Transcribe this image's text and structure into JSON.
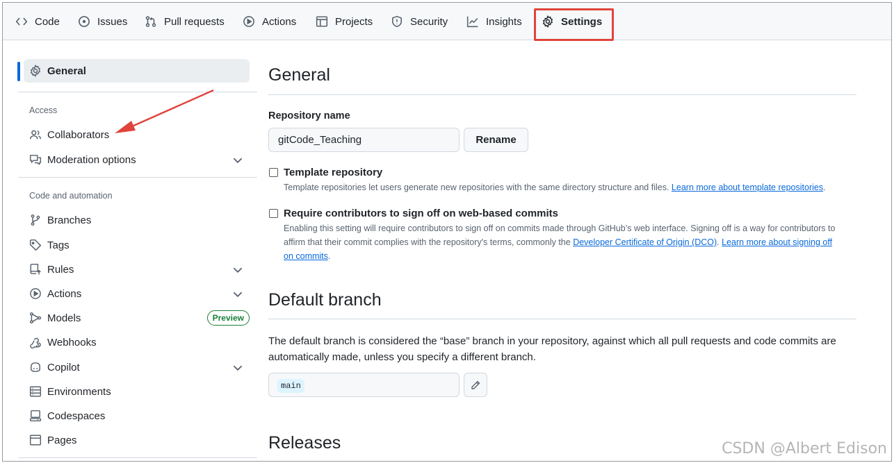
{
  "repo_nav": {
    "tabs": [
      {
        "label": "Code",
        "icon": "code-icon"
      },
      {
        "label": "Issues",
        "icon": "issue-icon"
      },
      {
        "label": "Pull requests",
        "icon": "pull-request-icon"
      },
      {
        "label": "Actions",
        "icon": "play-icon"
      },
      {
        "label": "Projects",
        "icon": "table-icon"
      },
      {
        "label": "Security",
        "icon": "shield-icon"
      },
      {
        "label": "Insights",
        "icon": "graph-icon"
      },
      {
        "label": "Settings",
        "icon": "gear-icon",
        "active": true
      }
    ],
    "highlight_color": "#e0443c"
  },
  "sidebar": {
    "general": "General",
    "access_heading": "Access",
    "collaborators": "Collaborators",
    "moderation_options": "Moderation options",
    "code_automation_heading": "Code and automation",
    "branches": "Branches",
    "tags": "Tags",
    "rules": "Rules",
    "actions": "Actions",
    "models": "Models",
    "models_badge": "Preview",
    "webhooks": "Webhooks",
    "copilot": "Copilot",
    "environments": "Environments",
    "codespaces": "Codespaces",
    "pages": "Pages",
    "accent_color": "#0969da"
  },
  "main": {
    "general_title": "General",
    "repo_name_label": "Repository name",
    "repo_name_value": "gitCode_Teaching",
    "rename_button": "Rename",
    "template_title": "Template repository",
    "template_note": "Template repositories let users generate new repositories with the same directory structure and files.",
    "template_link": "Learn more about template repositories",
    "signoff_title": "Require contributors to sign off on web-based commits",
    "signoff_note_1": "Enabling this setting will require contributors to sign off on commits made through GitHub’s web interface. Signing off is a way for contributors to affirm that their commit complies with the repository's terms, commonly the",
    "signoff_link_dco": "Developer Certificate of Origin (DCO)",
    "signoff_link_learn": "Learn more about signing off on commits",
    "default_branch_title": "Default branch",
    "default_branch_desc": "The default branch is considered the “base” branch in your repository, against which all pull requests and code commits are automatically made, unless you specify a different branch.",
    "default_branch_value": "main",
    "releases_title": "Releases"
  },
  "watermark": "CSDN @Albert Edison"
}
